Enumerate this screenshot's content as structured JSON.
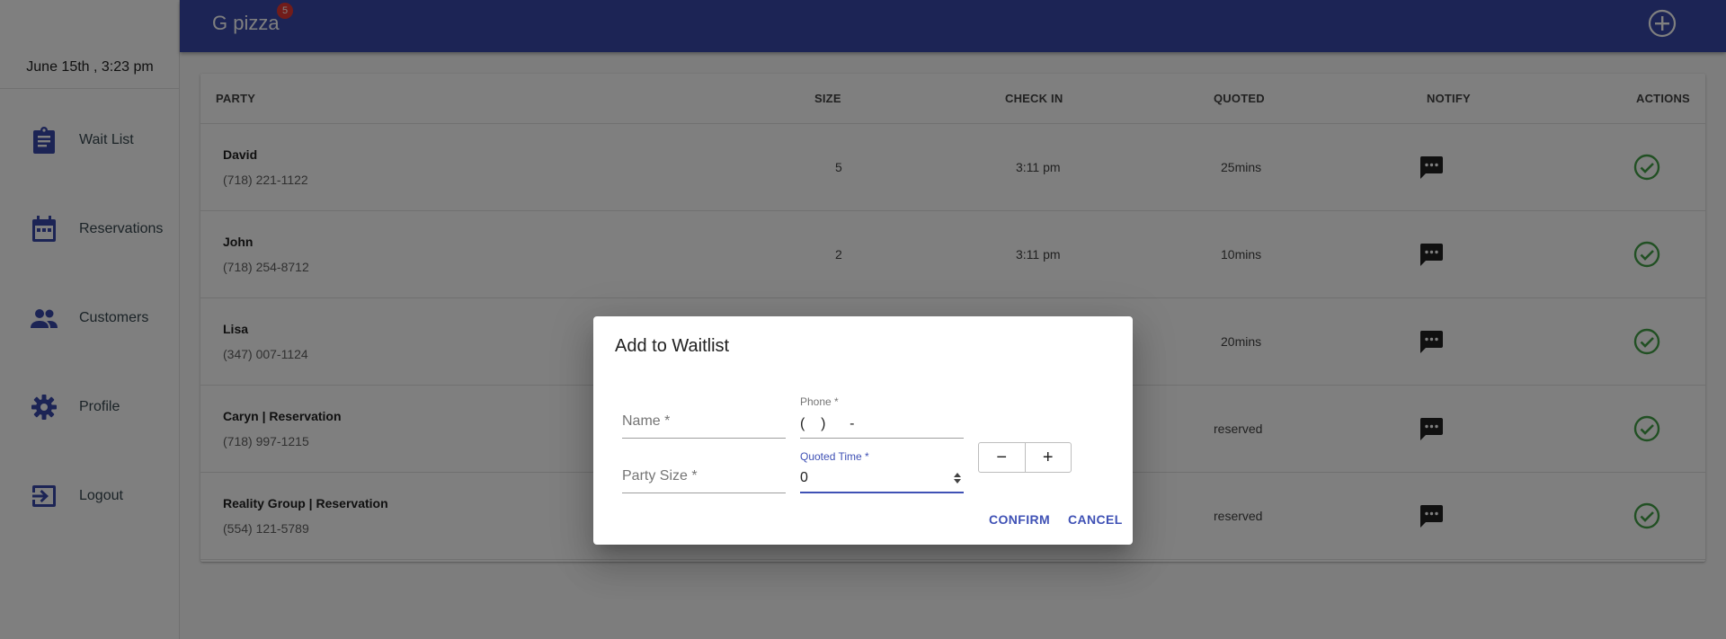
{
  "sidebar": {
    "datetime": "June 15th , 3:23 pm",
    "items": [
      {
        "label": "Wait List",
        "icon": "clipboard-icon"
      },
      {
        "label": "Reservations",
        "icon": "calendar-icon"
      },
      {
        "label": "Customers",
        "icon": "people-icon"
      },
      {
        "label": "Profile",
        "icon": "gear-icon"
      },
      {
        "label": "Logout",
        "icon": "logout-icon"
      }
    ]
  },
  "topbar": {
    "title": "G pizza",
    "badge_count": "5",
    "add_icon": "add-circle-icon"
  },
  "table": {
    "headers": {
      "party": "PARTY",
      "size": "SIZE",
      "check_in": "CHECK IN",
      "quoted": "QUOTED",
      "notify": "NOTIFY",
      "actions": "ACTIONS"
    },
    "rows": [
      {
        "name": "David",
        "phone": "(718) 221-1122",
        "size": "5",
        "check_in": "3:11 pm",
        "quoted": "25mins"
      },
      {
        "name": "John",
        "phone": "(718) 254-8712",
        "size": "2",
        "check_in": "3:11 pm",
        "quoted": "10mins"
      },
      {
        "name": "Lisa",
        "phone": "(347) 007-1124",
        "size": "",
        "check_in": "",
        "quoted": "20mins"
      },
      {
        "name": "Caryn | Reservation",
        "phone": "(718) 997-1215",
        "size": "",
        "check_in": "",
        "quoted": "reserved"
      },
      {
        "name": "Reality Group | Reservation",
        "phone": "(554) 121-5789",
        "size": "",
        "check_in": "",
        "quoted": "reserved"
      }
    ],
    "notify_icon": "message-icon",
    "action_icon": "check-circle-icon"
  },
  "dialog": {
    "title": "Add to Waitlist",
    "name_label": "Name *",
    "phone_label": "Phone *",
    "phone_value": "(    )      -",
    "party_size_label": "Party Size *",
    "quoted_time_label": "Quoted Time *",
    "quoted_time_value": "0",
    "minus_label": "−",
    "plus_label": "+",
    "confirm_label": "CONFIRM",
    "cancel_label": "CANCEL"
  },
  "colors": {
    "primary": "#3949ab",
    "accent": "#3f51b5",
    "badge": "#e53935",
    "success": "#43a047"
  }
}
